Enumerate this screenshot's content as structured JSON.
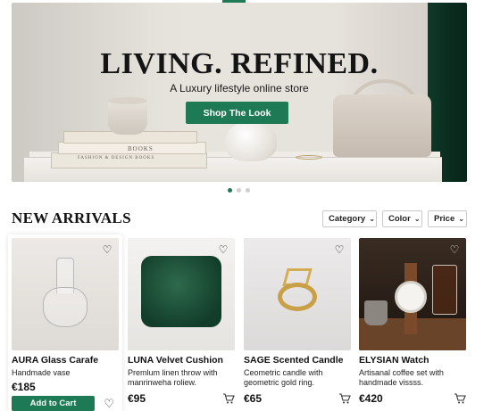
{
  "hero": {
    "title": "LIVING. REFINED.",
    "subtitle": "A Luxury lifestyle online store",
    "cta_label": "Shop The Look",
    "book_spine_1": "BOOKS",
    "book_spine_2": "FASHION & DESIGN BOOKS",
    "active_slide": 1,
    "slide_count": 3
  },
  "section": {
    "title": "NEW ARRIVALS"
  },
  "filters": [
    {
      "label": "Category"
    },
    {
      "label": "Color"
    },
    {
      "label": "Price"
    }
  ],
  "products": [
    {
      "name": "AURA Glass Carafe",
      "description": "Handmade vase",
      "price": "€185",
      "action_label": "Add to Cart",
      "icon": "heart-icon"
    },
    {
      "name": "LUNA Velvet Cushion",
      "description": "Premlum linen throw with manrinweha roliew.",
      "price": "€95",
      "icon": "cart-icon"
    },
    {
      "name": "SAGE Scented Candle",
      "description": "Ceometric candle with geometric gold ring.",
      "price": "€65",
      "icon": "cart-icon"
    },
    {
      "name": "ELYSIAN Watch",
      "description": "Artisanal coffee set with handmade vissss.",
      "price": "€420",
      "icon": "cart-icon"
    }
  ],
  "colors": {
    "accent": "#1d7a54",
    "curtain": "#0a2c1e"
  }
}
